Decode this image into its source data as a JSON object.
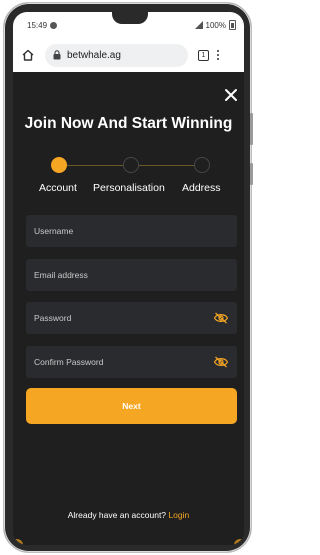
{
  "status_bar": {
    "time": "15:49",
    "battery": "100%"
  },
  "browser": {
    "url": "betwhale.ag",
    "tab_count": "1"
  },
  "modal": {
    "title": "Join Now And Start Winning",
    "steps": [
      {
        "label": "Account",
        "active": true
      },
      {
        "label": "Personalisation",
        "active": false
      },
      {
        "label": "Address",
        "active": false
      }
    ],
    "fields": {
      "username_placeholder": "Username",
      "email_placeholder": "Email address",
      "password_placeholder": "Password",
      "confirm_password_placeholder": "Confirm Password"
    },
    "next_label": "Next",
    "footer_text": "Already have an account?",
    "login_label": "Login"
  },
  "colors": {
    "accent": "#f5a623",
    "background": "#1f1f1f",
    "field": "#2a2b2e"
  },
  "icons": {
    "close": "close-icon",
    "eye": "eye-off-icon",
    "home": "home-icon",
    "lock": "lock-icon"
  }
}
